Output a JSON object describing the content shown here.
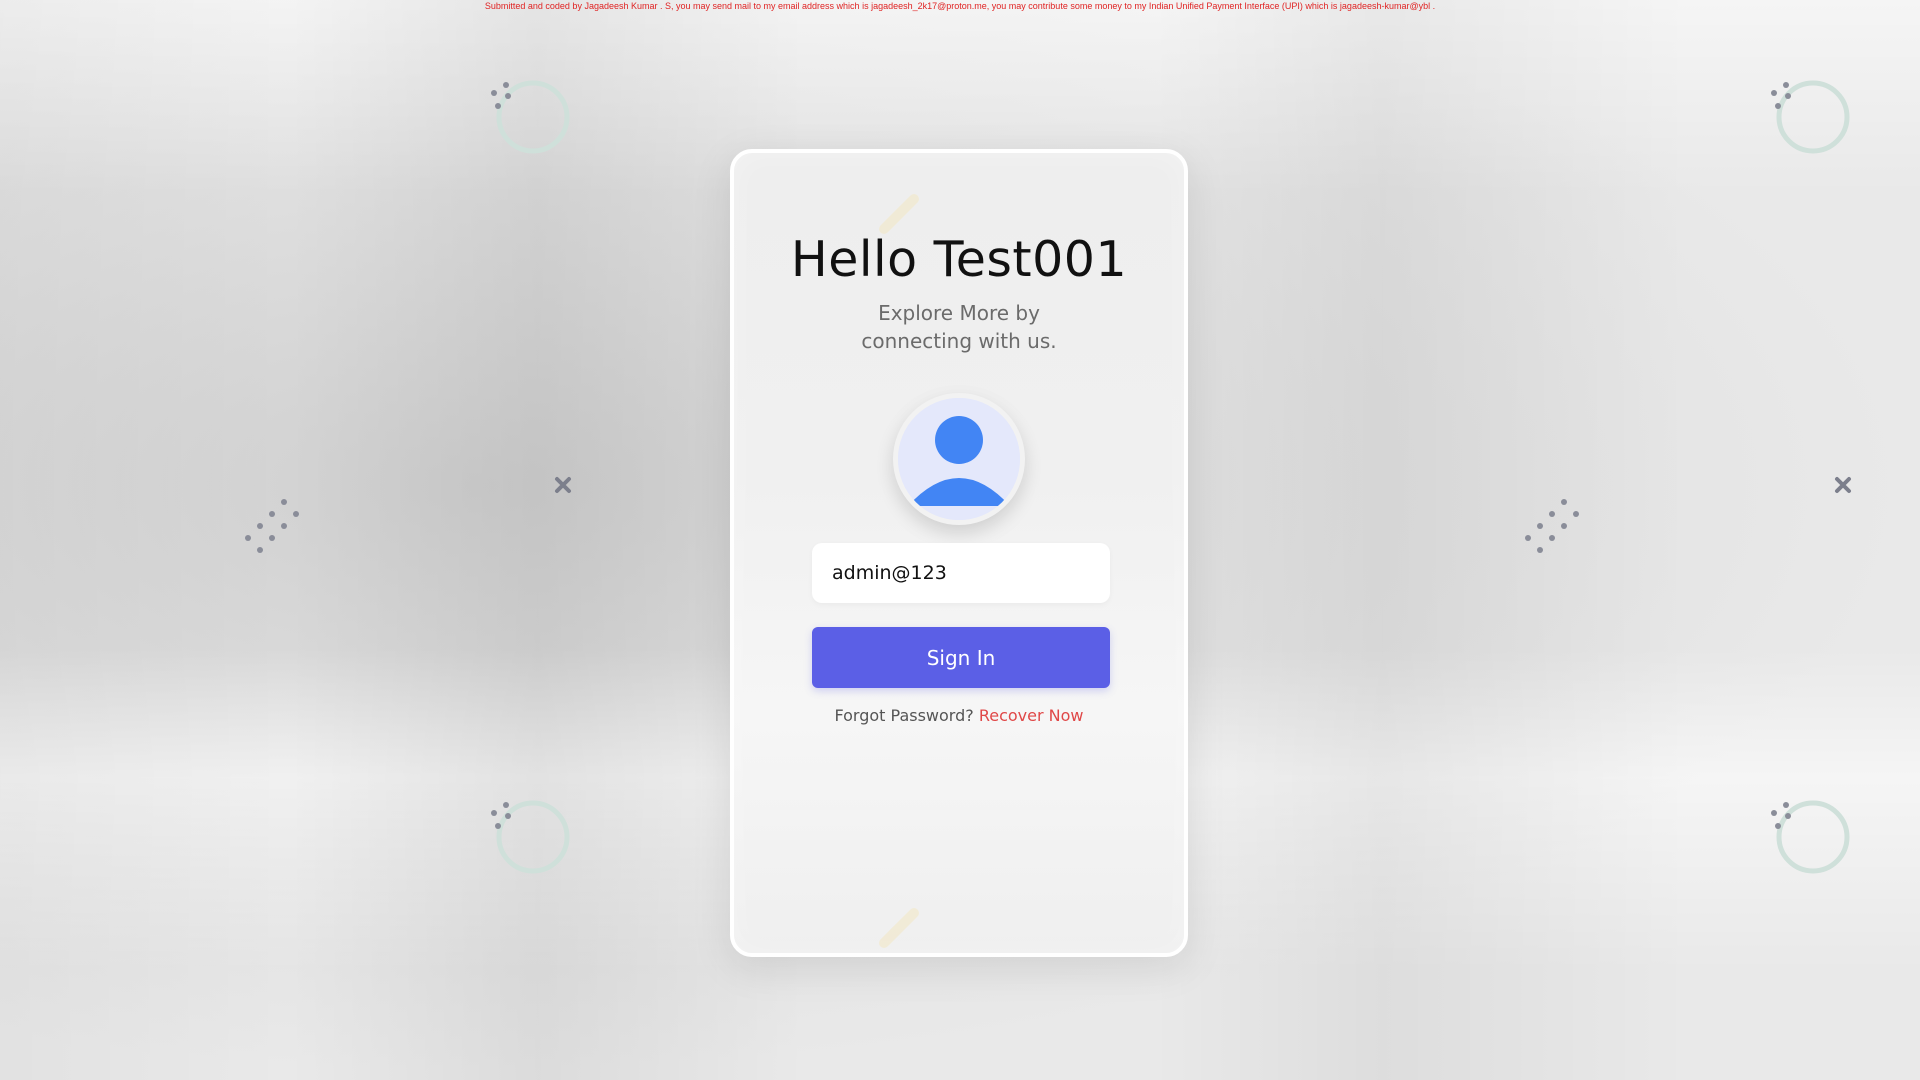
{
  "credit_text": "Submitted and coded by Jagadeesh Kumar . S, you may send mail to my email address which is jagadeesh_2k17@proton.me, you may contribute some money to my Indian Unified Payment Interface (UPI) which is jagadeesh-kumar@ybl .",
  "card": {
    "title": "Hello Test001",
    "subtitle": "Explore More by connecting with us.",
    "avatar_icon": "user-avatar-icon",
    "email_value": "admin@123",
    "signin_label": "Sign In",
    "forgot_text": "Forgot Password?",
    "recover_label": "Recover Now"
  },
  "colors": {
    "accent": "#5b5fe6",
    "link": "#e04848",
    "avatar_blue": "#4285f4",
    "credit": "#e02424"
  },
  "decorations": {
    "ring_icon": "ring-icon",
    "dots_icon": "dots-icon",
    "cross_icon": "cross-icon"
  }
}
